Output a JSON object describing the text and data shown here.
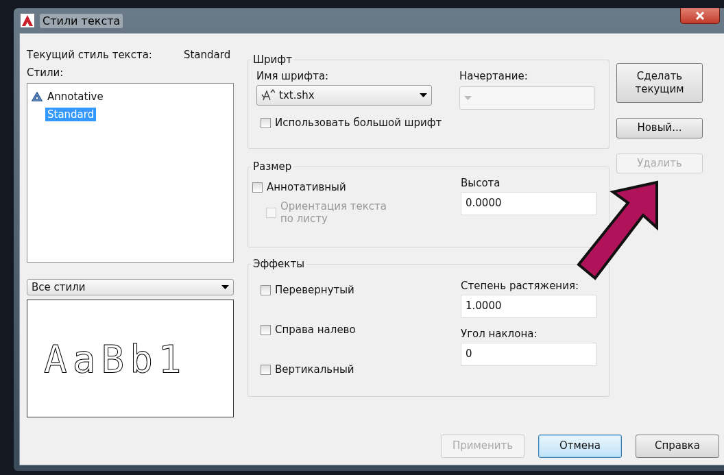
{
  "window": {
    "title": "Стили текста"
  },
  "current_style": {
    "label": "Текущий стиль текста:",
    "value": "Standard"
  },
  "styles": {
    "label": "Стили:",
    "items": [
      {
        "name": "Annotative",
        "annotative": true,
        "selected": false
      },
      {
        "name": "Standard",
        "annotative": false,
        "selected": true
      }
    ]
  },
  "filter": {
    "value": "Все стили"
  },
  "preview": {
    "text": "AaBb1"
  },
  "font": {
    "title": "Шрифт",
    "name_label": "Имя шрифта:",
    "name_value": "txt.shx",
    "style_label": "Начертание:",
    "style_disabled": true,
    "big_font": {
      "label": "Использовать большой шрифт",
      "checked": false,
      "disabled": false
    }
  },
  "size": {
    "title": "Размер",
    "annotative": {
      "label": "Аннотативный",
      "checked": false,
      "disabled": false
    },
    "orientation": {
      "label": "Ориентация текста по листу",
      "checked": false,
      "disabled": true
    },
    "height_label": "Высота",
    "height_value": "0.0000"
  },
  "effects": {
    "title": "Эффекты",
    "checkboxes": [
      {
        "label": "Перевернутый",
        "checked": false,
        "disabled": false
      },
      {
        "label": "Справа налево",
        "checked": false,
        "disabled": false
      },
      {
        "label": "Вертикальный",
        "checked": false,
        "disabled": false
      }
    ],
    "width_label": "Степень растяжения:",
    "width_value": "1.0000",
    "oblique_label": "Угол наклона:",
    "oblique_value": "0"
  },
  "side_buttons": [
    {
      "label": "Сделать текущим",
      "disabled": false
    },
    {
      "label": "Новый...",
      "disabled": false
    },
    {
      "label": "Удалить",
      "disabled": true
    }
  ],
  "bottom_buttons": [
    {
      "label": "Применить",
      "disabled": true,
      "focused": false
    },
    {
      "label": "Отмена",
      "disabled": false,
      "focused": true
    },
    {
      "label": "Справка",
      "disabled": false,
      "focused": false
    }
  ]
}
